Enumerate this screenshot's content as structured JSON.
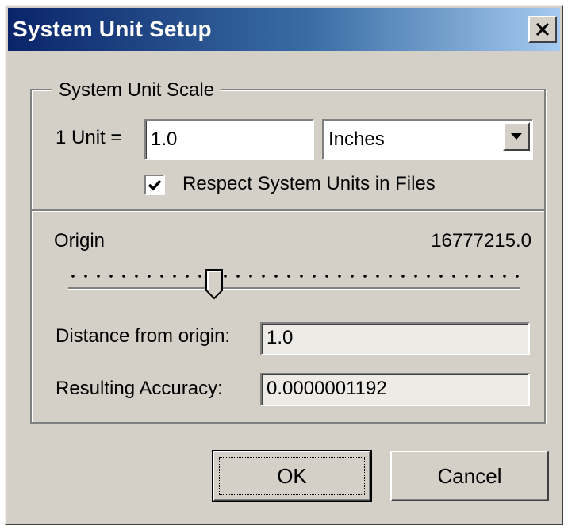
{
  "window": {
    "title": "System Unit Setup",
    "close_label": "×"
  },
  "unit_scale": {
    "group_title": "System Unit Scale",
    "unit_label": "1 Unit =",
    "unit_value": "1.0",
    "unit_type": "Inches",
    "respect_checked": true,
    "respect_label": "Respect System Units in Files"
  },
  "origin": {
    "label": "Origin",
    "value": "16777215.0",
    "slider_position": 0.3
  },
  "distance": {
    "label": "Distance from origin:",
    "value": "1.0"
  },
  "accuracy": {
    "label": "Resulting Accuracy:",
    "value": "0.0000001192"
  },
  "buttons": {
    "ok": "OK",
    "cancel": "Cancel"
  }
}
